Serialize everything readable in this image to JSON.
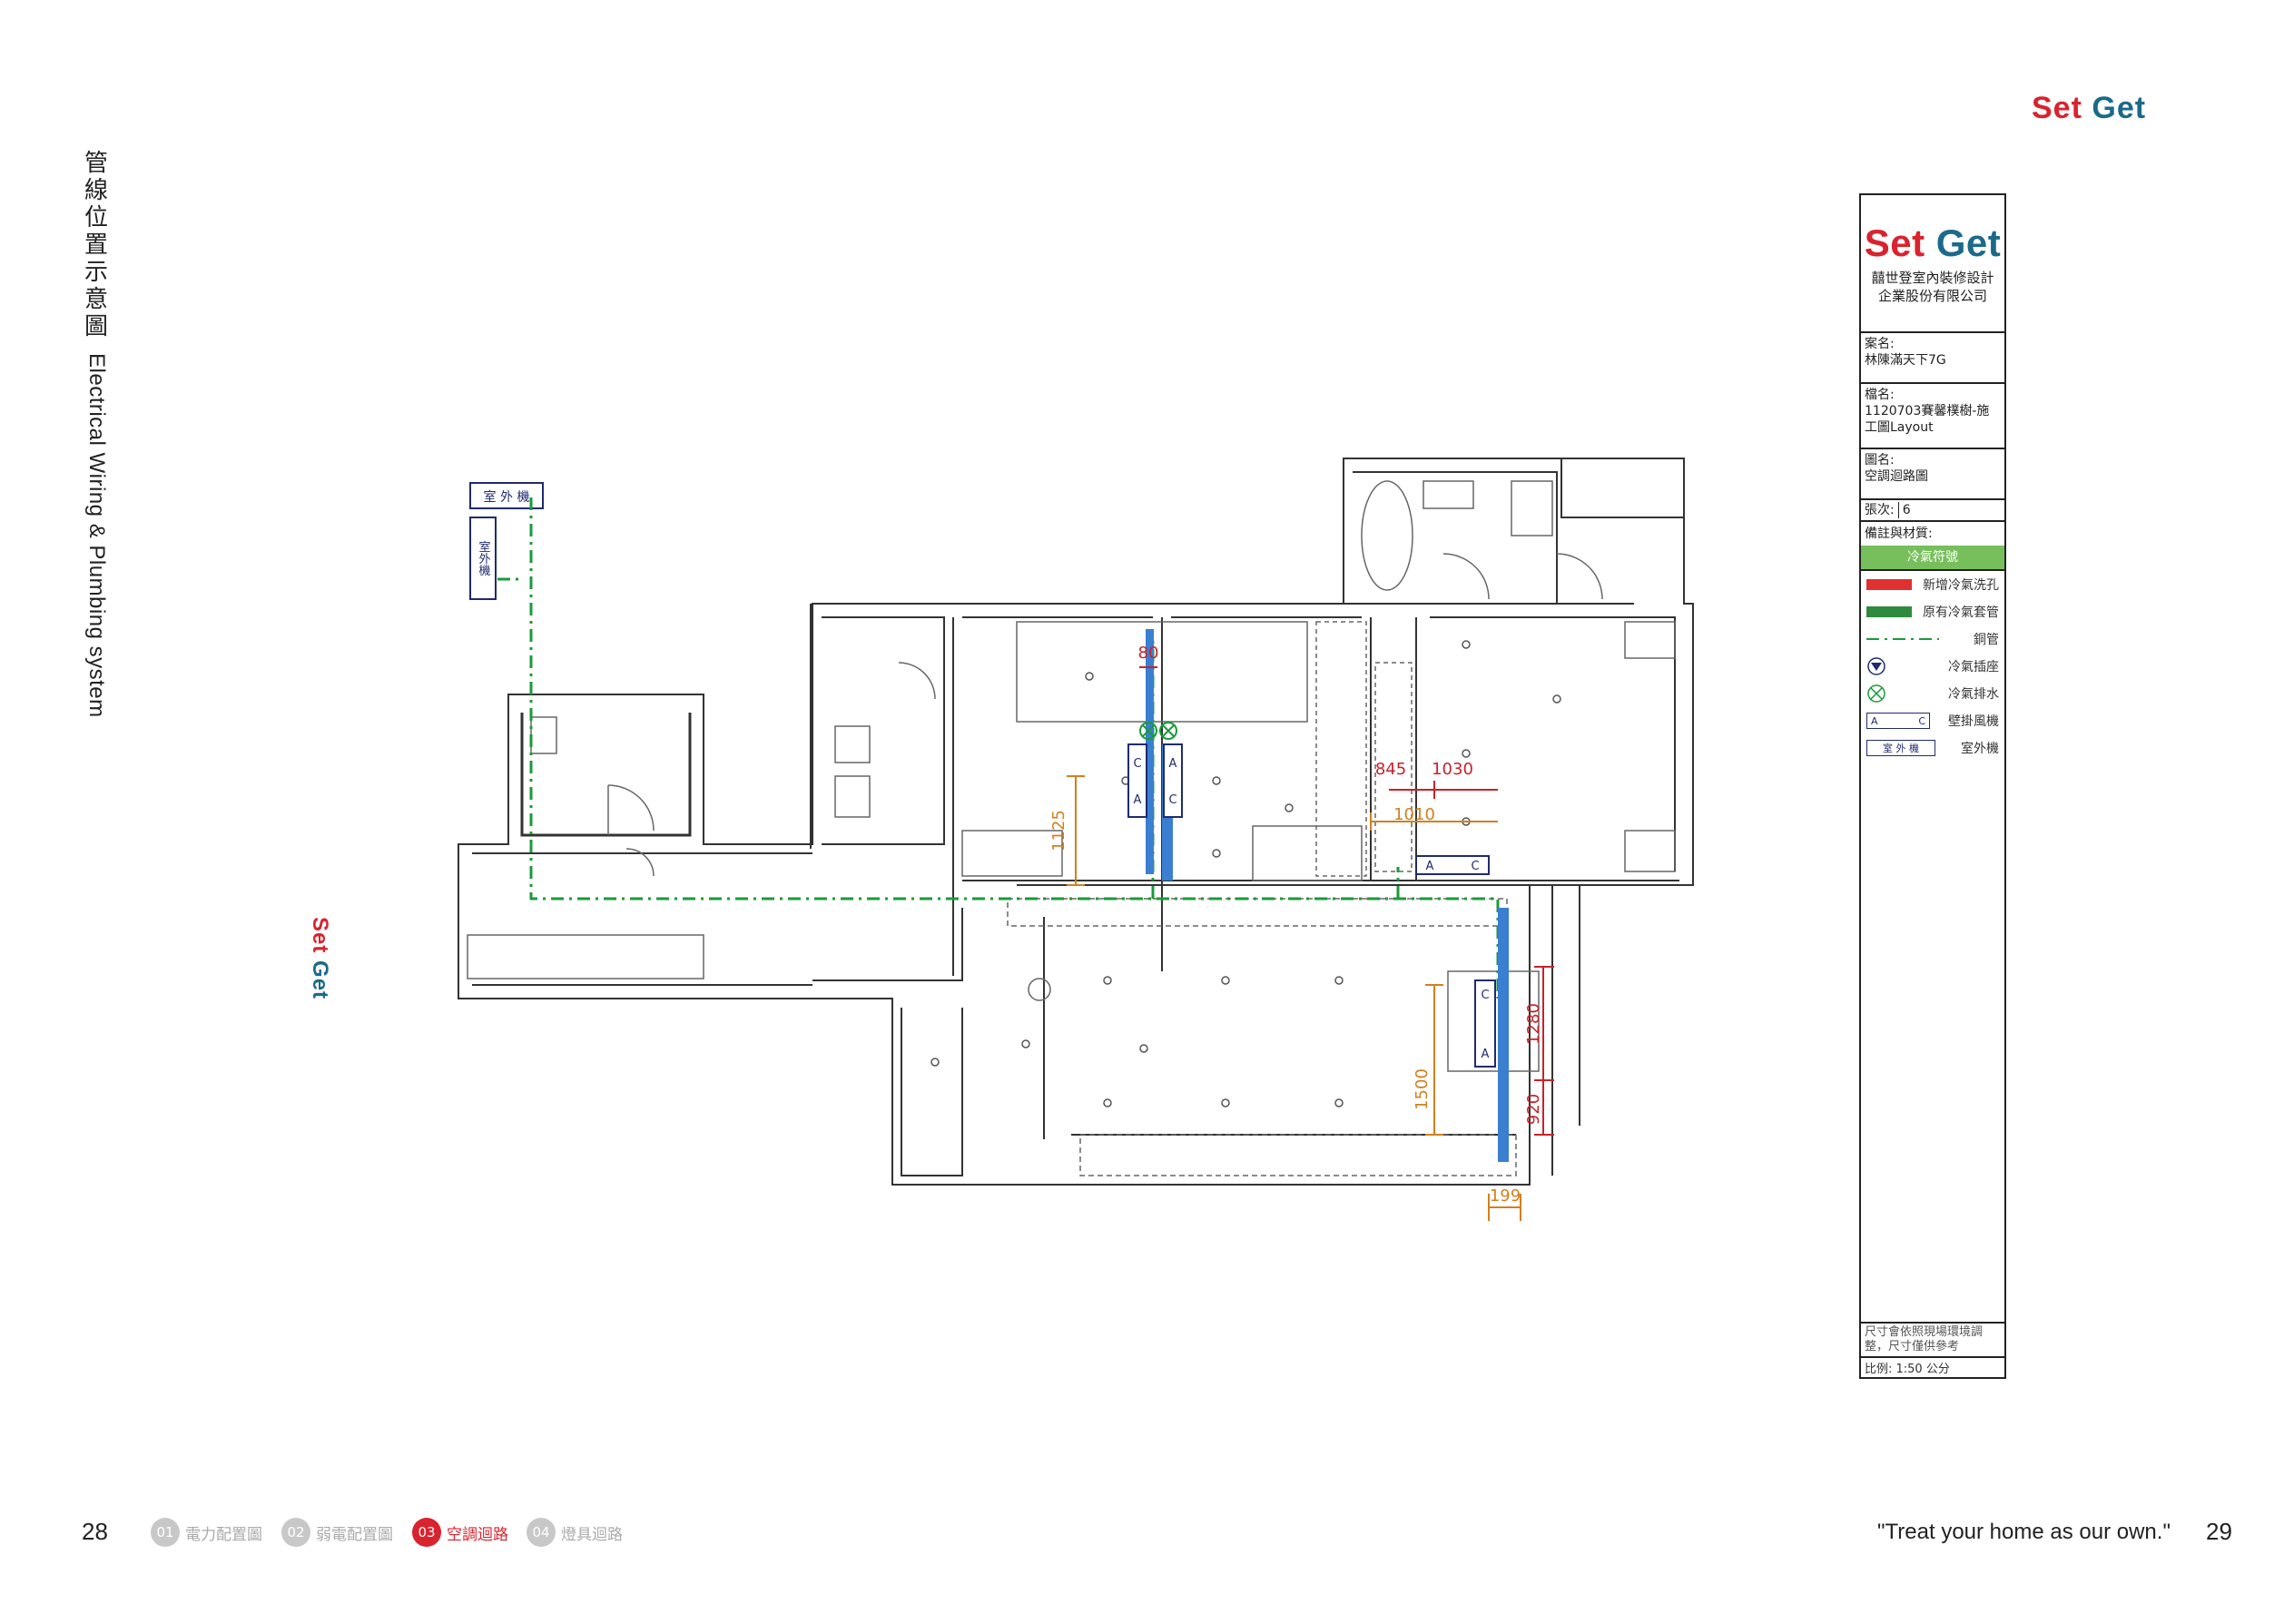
{
  "side_title": {
    "cjk": [
      "管",
      "線",
      "位",
      "置",
      "示",
      "意",
      "圖"
    ],
    "en": "Electrical Wiring & Plumbing system"
  },
  "brand": {
    "set": "Set",
    "get": "Get"
  },
  "title_block": {
    "company_line1": "囍世登室內裝修設計",
    "company_line2": "企業股份有限公司",
    "case_label": "案名:",
    "case_value": "林陳滿天下7G",
    "file_label": "檔名:",
    "file_value": "1120703賽馨樸樹-施工圖Layout",
    "drawing_label": "圖名:",
    "drawing_value": "空調迴路圖",
    "sheet_label": "張次:",
    "sheet_value": "6",
    "notes_label": "備註與材質:",
    "legend_title": "冷氣符號",
    "legend": [
      {
        "label": "新增冷氣洗孔",
        "icon": "red-bar"
      },
      {
        "label": "原有冷氣套管",
        "icon": "green-bar"
      },
      {
        "label": "銅管",
        "icon": "dash-dot-line"
      },
      {
        "label": "冷氣插座",
        "icon": "outlet-triangle"
      },
      {
        "label": "冷氣排水",
        "icon": "drain-cross"
      },
      {
        "label": "壁掛風機",
        "icon": "wall-unit-ac"
      },
      {
        "label": "室外機",
        "icon": "outdoor-unit"
      }
    ],
    "legend_ac_a": "A",
    "legend_ac_c": "C",
    "legend_outdoor": "室 外 機",
    "footnote": "尺寸會依照現場環境調整，尺寸僅供參考",
    "scale": "比例: 1:50 公分"
  },
  "plan": {
    "outdoor_label": "室 外 機",
    "outdoor_label_vert": "室外機",
    "ac_a": "A",
    "ac_c": "C",
    "dimensions": {
      "d80": "80",
      "d1125": "1125",
      "d845": "845",
      "d1030": "1030",
      "d1010": "1010",
      "d1280": "1280",
      "d1500": "1500",
      "d920": "920",
      "d199": "199"
    },
    "colors": {
      "copper_pipe": "#1a9a3a",
      "new_hole": "#e03030",
      "sleeve": "#2e8b3e",
      "wall_unit_band": "#3a7fd0",
      "dim_red": "#c8222a",
      "dim_orange": "#d2801e"
    }
  },
  "footer": {
    "page_left": "28",
    "page_right": "29",
    "nav": [
      {
        "num": "01",
        "label": "電力配置圖"
      },
      {
        "num": "02",
        "label": "弱電配置圖"
      },
      {
        "num": "03",
        "label": "空調迴路"
      },
      {
        "num": "04",
        "label": "燈具迴路"
      }
    ],
    "quote": "\"Treat your home as our own.\""
  }
}
